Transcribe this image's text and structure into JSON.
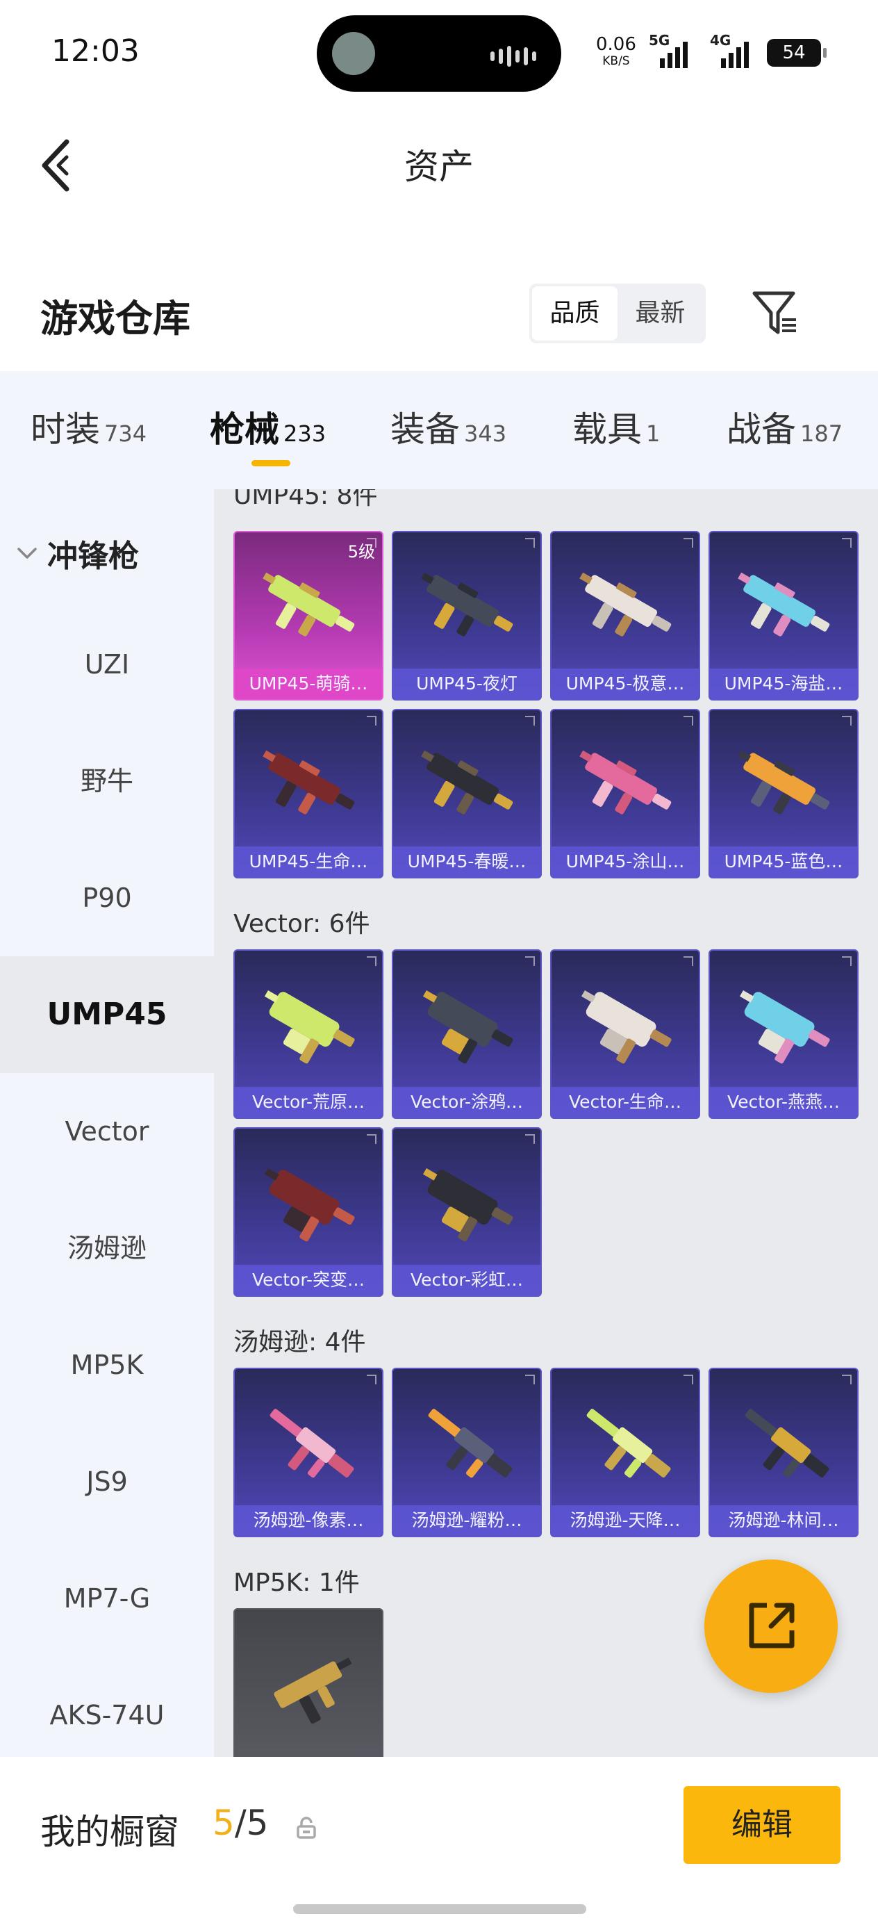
{
  "status_bar": {
    "time": "12:03",
    "net_speed": "0.06",
    "net_speed_unit": "KB/S",
    "signal1_type": "5G",
    "signal2_type": "4G",
    "battery": "54"
  },
  "header": {
    "title": "资产"
  },
  "warehouse": {
    "title": "游戏仓库",
    "sort_options": [
      "品质",
      "最新"
    ],
    "active_sort": "品质"
  },
  "tabs": [
    {
      "label": "时装",
      "count": "734"
    },
    {
      "label": "枪械",
      "count": "233",
      "active": true
    },
    {
      "label": "装备",
      "count": "343"
    },
    {
      "label": "载具",
      "count": "1"
    },
    {
      "label": "战备",
      "count": "187"
    }
  ],
  "sidebar": {
    "group": "冲锋枪",
    "items": [
      "UZI",
      "野牛",
      "P90",
      "UMP45",
      "Vector",
      "汤姆逊",
      "MP5K",
      "JS9",
      "MP7-G",
      "AKS-74U"
    ],
    "active": "UMP45"
  },
  "sections": [
    {
      "title": "UMP45: 8件",
      "items": [
        {
          "name": "UMP45-萌骑…",
          "level": "5级",
          "tier": "pink"
        },
        {
          "name": "UMP45-夜灯",
          "tier": "purple"
        },
        {
          "name": "UMP45-极意…",
          "tier": "purple"
        },
        {
          "name": "UMP45-海盐…",
          "tier": "purple"
        },
        {
          "name": "UMP45-生命…",
          "tier": "purple"
        },
        {
          "name": "UMP45-春暖…",
          "tier": "purple"
        },
        {
          "name": "UMP45-涂山…",
          "tier": "purple"
        },
        {
          "name": "UMP45-蓝色…",
          "tier": "purple"
        }
      ]
    },
    {
      "title": "Vector: 6件",
      "items": [
        {
          "name": "Vector-荒原…",
          "tier": "purple"
        },
        {
          "name": "Vector-涂鸦…",
          "tier": "purple"
        },
        {
          "name": "Vector-生命…",
          "tier": "purple"
        },
        {
          "name": "Vector-燕燕…",
          "tier": "purple"
        },
        {
          "name": "Vector-突变…",
          "tier": "purple"
        },
        {
          "name": "Vector-彩虹…",
          "tier": "purple"
        }
      ]
    },
    {
      "title": "汤姆逊: 4件",
      "items": [
        {
          "name": "汤姆逊-像素…",
          "tier": "purple"
        },
        {
          "name": "汤姆逊-耀粉…",
          "tier": "purple"
        },
        {
          "name": "汤姆逊-天降…",
          "tier": "purple"
        },
        {
          "name": "汤姆逊-林间…",
          "tier": "purple"
        }
      ]
    },
    {
      "title": "MP5K: 1件",
      "items": [
        {
          "name": "",
          "tier": "gray"
        }
      ]
    }
  ],
  "showcase": {
    "label": "我的橱窗",
    "used": "5",
    "total": "/5",
    "edit_label": "编辑"
  },
  "colors": {
    "accent_yellow": "#fbb70c",
    "epic_purple": "#5d56c6",
    "legendary_pink": "#e05ad2"
  }
}
